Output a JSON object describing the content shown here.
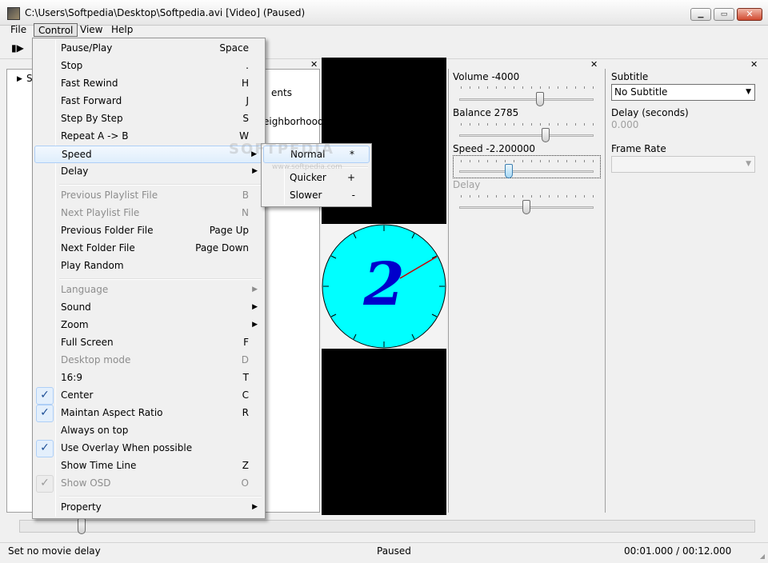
{
  "window": {
    "title": "C:\\Users\\Softpedia\\Desktop\\Softpedia.avi [Video] (Paused)"
  },
  "menubar": {
    "file": "File",
    "control": "Control",
    "view": "View",
    "help": "Help"
  },
  "tree": {
    "root_label": "S",
    "item1": "ents",
    "item2": "eighborhood"
  },
  "watermark": {
    "main": "SOFTPEDIA",
    "sub": "www.softpedia.com"
  },
  "audio_panel": {
    "volume_label": "Volume -4000",
    "volume_level": 0.6,
    "balance_label": "Balance 2785",
    "balance_level": 0.64,
    "speed_label": "Speed -2.200000",
    "speed_level": 0.37,
    "delay_label": "Delay",
    "delay_level": 0.5
  },
  "subtitle_panel": {
    "subtitle_label": "Subtitle",
    "subtitle_value": "No Subtitle",
    "delay_label": "Delay (seconds)",
    "delay_value": "0.000",
    "framerate_label": "Frame Rate",
    "framerate_value": ""
  },
  "control_menu": {
    "items": [
      {
        "label": "Pause/Play",
        "shortcut": "Space"
      },
      {
        "label": "Stop",
        "shortcut": "."
      },
      {
        "label": "Fast Rewind",
        "shortcut": "H"
      },
      {
        "label": "Fast Forward",
        "shortcut": "J"
      },
      {
        "label": "Step By Step",
        "shortcut": "S"
      },
      {
        "label": "Repeat A -> B",
        "shortcut": "W"
      },
      {
        "label": "Speed",
        "shortcut": ""
      },
      {
        "label": "Delay",
        "shortcut": ""
      },
      {
        "label": "Previous Playlist File",
        "shortcut": "B"
      },
      {
        "label": "Next Playlist File",
        "shortcut": "N"
      },
      {
        "label": "Previous Folder File",
        "shortcut": "Page Up"
      },
      {
        "label": "Next Folder File",
        "shortcut": "Page Down"
      },
      {
        "label": "Play Random",
        "shortcut": ""
      },
      {
        "label": "Language",
        "shortcut": ""
      },
      {
        "label": "Sound",
        "shortcut": ""
      },
      {
        "label": "Zoom",
        "shortcut": ""
      },
      {
        "label": "Full Screen",
        "shortcut": "F"
      },
      {
        "label": "Desktop mode",
        "shortcut": "D"
      },
      {
        "label": "16:9",
        "shortcut": "T"
      },
      {
        "label": "Center",
        "shortcut": "C"
      },
      {
        "label": "Maintan Aspect Ratio",
        "shortcut": "R"
      },
      {
        "label": "Always on top",
        "shortcut": ""
      },
      {
        "label": "Use Overlay When possible",
        "shortcut": ""
      },
      {
        "label": "Show Time Line",
        "shortcut": "Z"
      },
      {
        "label": "Show OSD",
        "shortcut": "O"
      },
      {
        "label": "Property",
        "shortcut": ""
      }
    ]
  },
  "speed_submenu": {
    "items": [
      {
        "label": "Normal",
        "shortcut": "*"
      },
      {
        "label": "Quicker",
        "shortcut": "+"
      },
      {
        "label": "Slower",
        "shortcut": "-"
      }
    ]
  },
  "clock": {
    "digit": "2",
    "face_color": "#00ffff",
    "digit_color": "#0000cc",
    "hand_color": "#cc0000"
  },
  "seek": {
    "position": 0.085
  },
  "status": {
    "left": "Set no movie delay",
    "center": "Paused",
    "right": "00:01.000 / 00:12.000"
  }
}
